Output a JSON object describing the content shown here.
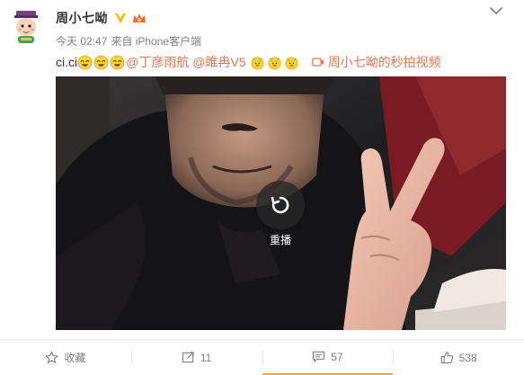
{
  "user": {
    "name": "周小七呦"
  },
  "post": {
    "time": "今天 02:47",
    "source": "来自 iPhone客户端",
    "text_prefix": "ci.ci",
    "mention1": "@丁彦雨航",
    "mention2": "@睢冉V5",
    "video_link_label": "周小七呦的秒拍视频"
  },
  "video": {
    "replay_label": "重播"
  },
  "actions": {
    "favorite_label": "收藏",
    "repost_count": "11",
    "comment_count": "57",
    "like_count": "538"
  },
  "icons": {
    "avatar": "cartoon-avatar-icon",
    "menu": "chevron-down-icon",
    "verified": "yellow-v-verified-icon",
    "member": "crown-member-icon",
    "emoji_cry": "laugh-cry-emoji-icon",
    "emoji_kneel": "kneel-emoji-icon",
    "video": "video-camera-icon",
    "replay": "replay-icon",
    "favorite": "star-icon",
    "repost": "repost-icon",
    "comment": "comment-icon",
    "like": "thumbs-up-icon"
  },
  "colors": {
    "link": "#eb7350",
    "meta": "#808080",
    "active_tab": "#f7a23b"
  }
}
